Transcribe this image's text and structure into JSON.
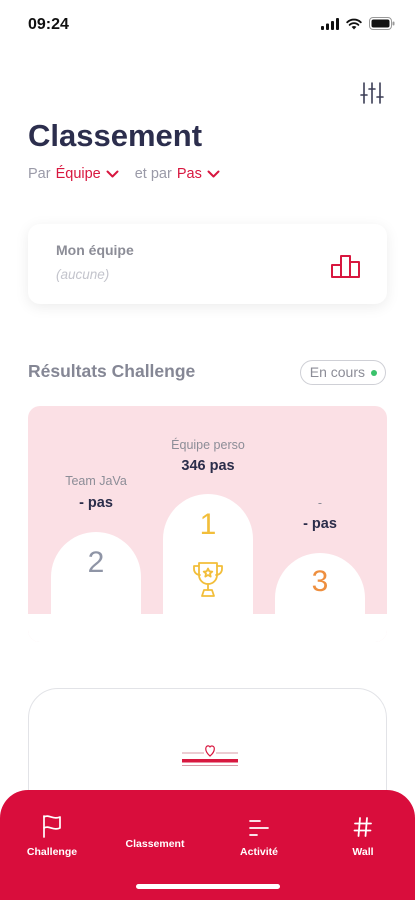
{
  "status_bar": {
    "time": "09:24"
  },
  "header": {
    "title": "Classement",
    "sort": {
      "prefix": "Par",
      "group_value": "Équipe",
      "joiner": "et par",
      "metric_value": "Pas"
    }
  },
  "team_card": {
    "label": "Mon équipe",
    "value": "(aucune)"
  },
  "results": {
    "title": "Résultats Challenge",
    "status": "En cours",
    "status_color": "#3ac26b",
    "podium": {
      "first": {
        "rank": "1",
        "name": "Équipe perso",
        "score": "346 pas"
      },
      "second": {
        "rank": "2",
        "name": "Team JaVa",
        "score": "- pas"
      },
      "third": {
        "rank": "3",
        "name": "-",
        "score": "- pas"
      }
    }
  },
  "tabbar": {
    "accent": "#d90d3c",
    "tabs": [
      {
        "label": "Challenge",
        "icon": "flag-icon"
      },
      {
        "label": "Classement",
        "icon": "none",
        "active": true
      },
      {
        "label": "Activité",
        "icon": "activity-lines-icon"
      },
      {
        "label": "Wall",
        "icon": "hash-icon"
      }
    ]
  }
}
